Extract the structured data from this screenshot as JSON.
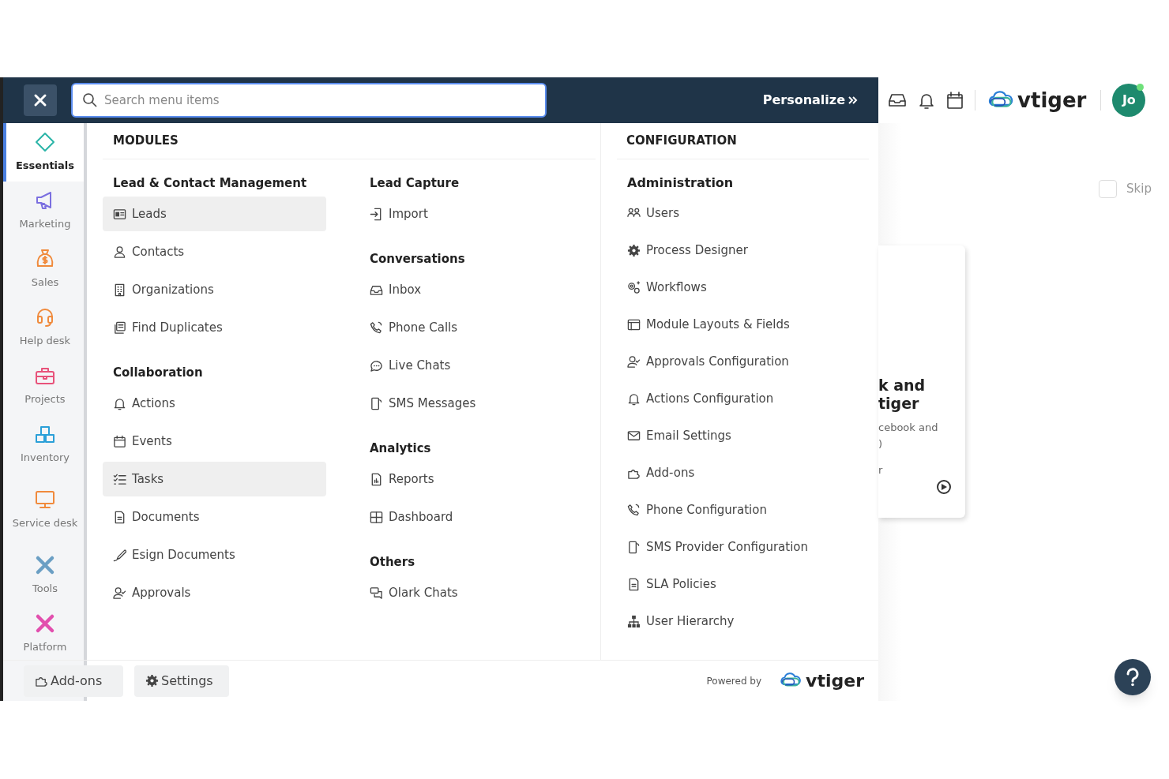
{
  "search": {
    "placeholder": "Search menu items"
  },
  "personalize": "Personalize",
  "sidebar": [
    {
      "label": "Essentials",
      "selected": true,
      "color": "#2bb5a8"
    },
    {
      "label": "Marketing",
      "selected": false,
      "color": "#7b6fe0"
    },
    {
      "label": "Sales",
      "selected": false,
      "color": "#f08a3c"
    },
    {
      "label": "Help desk",
      "selected": false,
      "color": "#f08a3c"
    },
    {
      "label": "Projects",
      "selected": false,
      "color": "#e8527a"
    },
    {
      "label": "Inventory",
      "selected": false,
      "color": "#2a9fd8"
    },
    {
      "label": "Service desk",
      "selected": false,
      "color": "#f08a3c"
    },
    {
      "label": "Tools",
      "selected": false,
      "color": "#6b9fc4"
    },
    {
      "label": "Platform",
      "selected": false,
      "color": "#e24fae"
    }
  ],
  "modules": {
    "title": "MODULES",
    "columns": [
      [
        {
          "heading": "Lead & Contact Management",
          "items": [
            {
              "label": "Leads",
              "selected": true
            },
            {
              "label": "Contacts",
              "selected": false
            },
            {
              "label": "Organizations",
              "selected": false
            },
            {
              "label": "Find Duplicates",
              "selected": false
            }
          ]
        },
        {
          "heading": "Collaboration",
          "items": [
            {
              "label": "Actions",
              "selected": false
            },
            {
              "label": "Events",
              "selected": false
            },
            {
              "label": "Tasks",
              "selected": true
            },
            {
              "label": "Documents",
              "selected": false
            },
            {
              "label": "Esign Documents",
              "selected": false
            },
            {
              "label": "Approvals",
              "selected": false
            }
          ]
        }
      ],
      [
        {
          "heading": "Lead Capture",
          "items": [
            {
              "label": "Import",
              "selected": false
            }
          ]
        },
        {
          "heading": "Conversations",
          "items": [
            {
              "label": "Inbox",
              "selected": false
            },
            {
              "label": "Phone Calls",
              "selected": false
            },
            {
              "label": "Live Chats",
              "selected": false
            },
            {
              "label": "SMS Messages",
              "selected": false
            }
          ]
        },
        {
          "heading": "Analytics",
          "items": [
            {
              "label": "Reports",
              "selected": false
            },
            {
              "label": "Dashboard",
              "selected": false
            }
          ]
        },
        {
          "heading": "Others",
          "items": [
            {
              "label": "Olark Chats",
              "selected": false
            }
          ]
        }
      ]
    ]
  },
  "configuration": {
    "title": "CONFIGURATION",
    "heading": "Administration",
    "items": [
      {
        "label": "Users",
        "selected": false
      },
      {
        "label": "Process Designer",
        "selected": false
      },
      {
        "label": "Workflows",
        "selected": false
      },
      {
        "label": "Module Layouts & Fields",
        "selected": false
      },
      {
        "label": "Approvals Configuration",
        "selected": false
      },
      {
        "label": "Actions Configuration",
        "selected": false
      },
      {
        "label": "Email Settings",
        "selected": false
      },
      {
        "label": "Add-ons",
        "selected": false
      },
      {
        "label": "Phone Configuration",
        "selected": false
      },
      {
        "label": "SMS Provider Configuration",
        "selected": false
      },
      {
        "label": "SLA Policies",
        "selected": false
      },
      {
        "label": "User Hierarchy",
        "selected": false
      }
    ]
  },
  "footer": {
    "buttons": [
      "Add-ons",
      "Settings"
    ],
    "powered_by": "Powered by",
    "brand": "vtiger"
  },
  "topbar": {
    "brand": "vtiger",
    "avatar": "Jo",
    "online": true
  },
  "skip": {
    "label": "Skip",
    "checked": false
  },
  "card": {
    "title_lines": [
      "k and",
      "tiger"
    ],
    "text_lines": [
      "cebook and",
      ")",
      "r"
    ]
  }
}
